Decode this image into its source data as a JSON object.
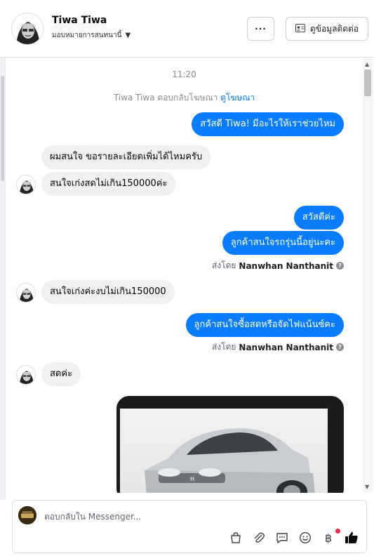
{
  "header": {
    "name": "Tiwa Tiwa",
    "assign_label": "มอบหมายการสนทนานี้",
    "more_label": "···",
    "contact_label": "ดูข้อมูลติดต่อ"
  },
  "chat": {
    "timestamp": "11:20",
    "ad_reply_prefix": "Tiwa Tiwa ตอบกลับโฆษณา",
    "ad_link": "ดูโฆษณา",
    "messages": [
      {
        "dir": "out",
        "text": "สวัสดี Tiwa! มีอะไรให้เราช่วยไหม"
      },
      {
        "dir": "in",
        "text": "ผมสนใจ ขอรายละเอียดเพิ่มได้ไหมครับ"
      },
      {
        "dir": "in",
        "text": "สนใจเก่งสดไม่เกิน150000ค่ะ"
      },
      {
        "dir": "out",
        "text": "สวัสดีค่ะ"
      },
      {
        "dir": "out",
        "text": "ลูกค้าสนใจรถรุ่นนี้อยู่นะคะ"
      },
      {
        "dir": "in",
        "text": "สนใจเก่งค่ะงบไม่เกิน150000"
      },
      {
        "dir": "out",
        "text": "ลูกค้าสนใจซื้อสดหรือจัดไฟแน้นซ์คะ"
      },
      {
        "dir": "in",
        "text": "สดค่ะ"
      }
    ],
    "sent_by_prefix": "ส่งโดย",
    "sent_by_name": "Nanwhan Nanthanit"
  },
  "composer": {
    "placeholder": "ตอบกลับใน Messenger..."
  },
  "icons": [
    "more-icon",
    "contact-card-icon",
    "caret-down-icon",
    "shopping-bag-icon",
    "attachment-icon",
    "saved-reply-icon",
    "emoji-icon",
    "baht-icon",
    "like-icon"
  ],
  "colors": {
    "accent": "#0a7cff",
    "incoming": "#eff0f2",
    "notification": "#f02849"
  }
}
